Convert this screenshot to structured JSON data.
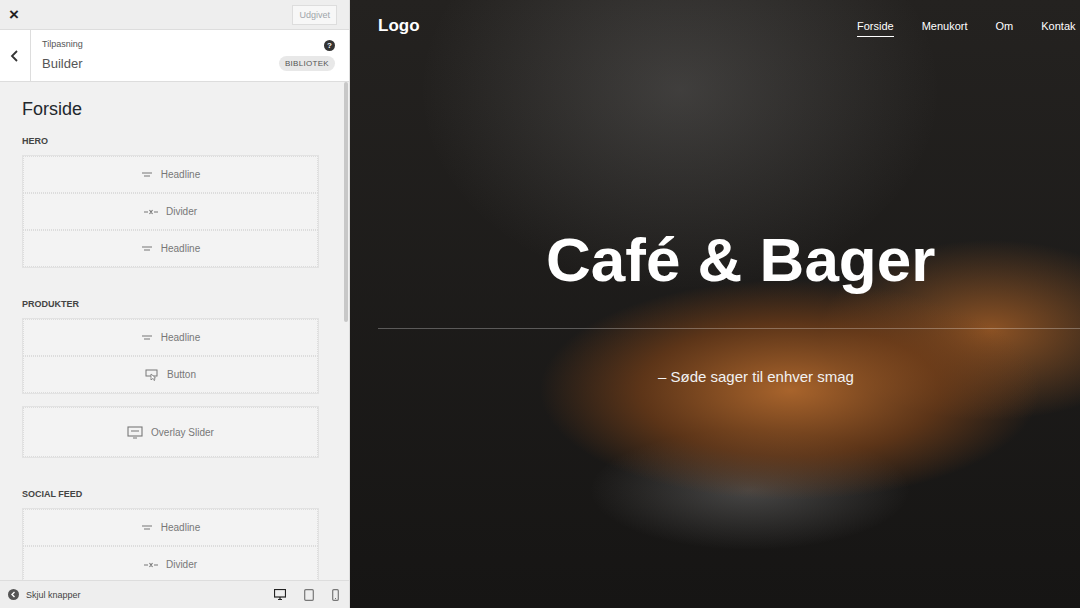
{
  "customizer": {
    "close": "×",
    "publish": {
      "label": "Udgivet",
      "disabled": true
    },
    "breadcrumb": "Tilpasning",
    "title": "Builder",
    "help": "?",
    "library": "BIBLIOTEK"
  },
  "page": {
    "title": "Forside",
    "sections": [
      {
        "name": "HERO",
        "groups": [
          [
            {
              "label": "Headline",
              "kind": "headline"
            },
            {
              "label": "Divider",
              "kind": "divider"
            },
            {
              "label": "Headline",
              "kind": "headline"
            }
          ]
        ]
      },
      {
        "name": "PRODUKTER",
        "groups": [
          [
            {
              "label": "Headline",
              "kind": "headline"
            },
            {
              "label": "Button",
              "kind": "button"
            }
          ],
          [
            {
              "label": "Overlay Slider",
              "kind": "slider"
            }
          ]
        ]
      },
      {
        "name": "SOCIAL FEED",
        "groups": [
          [
            {
              "label": "Headline",
              "kind": "headline"
            },
            {
              "label": "Divider",
              "kind": "divider"
            }
          ]
        ]
      }
    ]
  },
  "footer": {
    "hide": "Skjul knapper",
    "devices": [
      {
        "kind": "desktop",
        "selected": true
      },
      {
        "kind": "tablet",
        "selected": false
      },
      {
        "kind": "mobile",
        "selected": false
      }
    ]
  },
  "preview": {
    "logo": "Logo",
    "nav": [
      {
        "label": "Forside",
        "selected": true
      },
      {
        "label": "Menukort",
        "selected": false
      },
      {
        "label": "Om",
        "selected": false
      },
      {
        "label": "Kontak",
        "selected": false
      }
    ],
    "hero": {
      "title": "Café & Bager",
      "subtitle": "– Søde sager til enhver smag"
    }
  }
}
